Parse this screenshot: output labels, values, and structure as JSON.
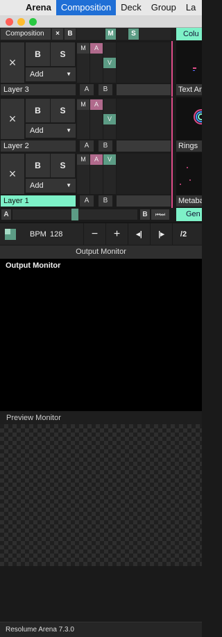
{
  "menubar": {
    "items": [
      "Arena",
      "Composition",
      "Deck",
      "Group",
      "La"
    ],
    "active_index": 1
  },
  "composition": {
    "label": "Composition",
    "close_label": "×",
    "b_label": "B",
    "m_label": "M",
    "s_label": "S",
    "column_tab": "Colu"
  },
  "layers": [
    {
      "name": "Layer 3",
      "close_label": "×",
      "b_label": "B",
      "s_label": "S",
      "add_label": "Add",
      "m_label": "M",
      "a_label": "A",
      "v_label": "V",
      "crossfade_a": "A",
      "crossfade_b": "B",
      "clip_name": "Text An",
      "active": false
    },
    {
      "name": "Layer 2",
      "close_label": "×",
      "b_label": "B",
      "s_label": "S",
      "add_label": "Add",
      "m_label": "M",
      "a_label": "A",
      "v_label": "V",
      "crossfade_a": "A",
      "crossfade_b": "B",
      "clip_name": "Rings",
      "active": false
    },
    {
      "name": "Layer 1",
      "close_label": "×",
      "b_label": "B",
      "s_label": "S",
      "add_label": "Add",
      "m_label": "M",
      "a_label": "A",
      "v_label": "V",
      "crossfade_a": "A",
      "crossfade_b": "B",
      "clip_name": "Metaba",
      "active": true
    }
  ],
  "crossfader": {
    "a_label": "A",
    "b_label": "B",
    "position": 0.5,
    "generator_tab": "Gen"
  },
  "transport": {
    "bpm_label": "BPM",
    "bpm_value": "128",
    "minus": "−",
    "plus": "+",
    "nudge_back": "◂|",
    "nudge_forward": "|▸",
    "half": "/2"
  },
  "output_monitor": {
    "header": "Output Monitor",
    "title": "Output Monitor"
  },
  "preview_monitor": {
    "title": "Preview Monitor"
  },
  "status": {
    "version": "Resolume Arena 7.3.0"
  },
  "colors": {
    "accent_teal": "#7ef1c8",
    "solo_green": "#5c9c85",
    "a_pink": "#b06a8c",
    "divider_pink": "#e04d8a",
    "menu_highlight": "#1f6fd6"
  }
}
